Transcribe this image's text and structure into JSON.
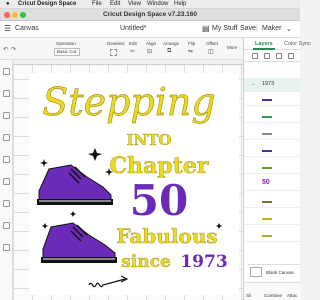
{
  "menubar": {
    "apple": "",
    "app": "Cricut Design Space",
    "items": [
      "File",
      "Edit",
      "View",
      "Window",
      "Help"
    ]
  },
  "window": {
    "title": "Cricut Design Space  v7.23.160"
  },
  "header": {
    "canvas_label": "Canvas",
    "doc_title": "Untitled*",
    "my_stuff": "My Stuff",
    "save": "Save",
    "maker": "Maker"
  },
  "toolbar": {
    "operation_label": "Operation",
    "operation_value": "Basic Cut",
    "deselect": "Deselect",
    "edit": "Edit",
    "align": "Align",
    "arrange": "Arrange",
    "flip": "Flip",
    "offset": "Offset",
    "more": "More"
  },
  "layers_panel": {
    "tab_layers": "Layers",
    "tab_color_sync": "Color Sync",
    "group_label": "1973",
    "blank_canvas_label": "Blank Canvas",
    "bottom_left": "Sli",
    "bottom_mid": "Combine",
    "bottom_right": "Attac",
    "layers": [
      {
        "thumb_color": "#5e2aa0"
      },
      {
        "thumb_color": "#2e9a5a"
      },
      {
        "thumb_color": "#888"
      },
      {
        "thumb_color": "#5e2aa0"
      },
      {
        "thumb_color": "#6d9c2e"
      },
      {
        "thumb_color": "#7a1fb2"
      },
      {
        "thumb_color": "#8a6a2e"
      },
      {
        "thumb_color": "#c7b21a"
      },
      {
        "thumb_color": "#9fb43c"
      }
    ],
    "layer50": "50"
  },
  "design": {
    "line1": "Stepping",
    "line2": "INTO",
    "line3": "Chapter",
    "line4": "50",
    "line5": "Fabulous",
    "line6": "since",
    "line7": "1973",
    "colors": {
      "gold": "#ecd91c",
      "purple": "#6b2ab8",
      "black": "#111111"
    }
  }
}
